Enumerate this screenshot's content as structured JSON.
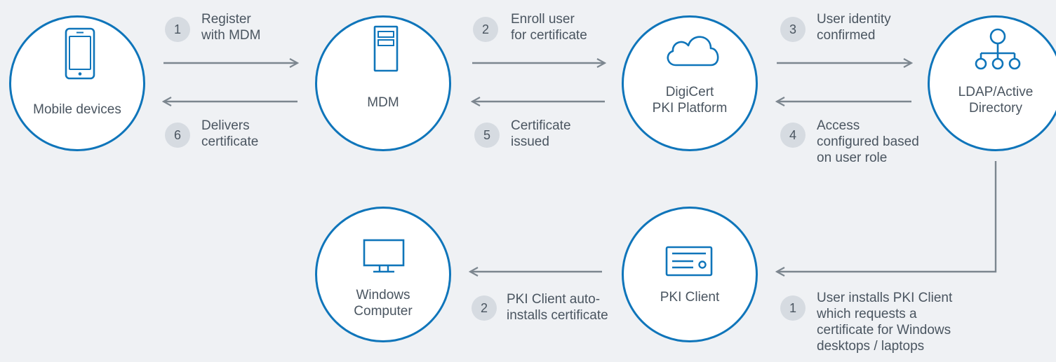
{
  "nodes": {
    "mobile": {
      "lines": [
        "Mobile devices"
      ],
      "icon": "mobile-phone-icon"
    },
    "mdm": {
      "lines": [
        "MDM"
      ],
      "icon": "server-tower-icon"
    },
    "digicert": {
      "lines": [
        "DigiCert",
        "PKI Platform"
      ],
      "icon": "cloud-icon"
    },
    "ldap": {
      "lines": [
        "LDAP/Active",
        "Directory"
      ],
      "icon": "hierarchy-icon"
    },
    "pki_client": {
      "lines": [
        "PKI Client"
      ],
      "icon": "certificate-card-icon"
    },
    "windows": {
      "lines": [
        "Windows",
        "Computer"
      ],
      "icon": "monitor-icon"
    }
  },
  "steps": {
    "s1_register": {
      "number": "1",
      "lines": [
        "Register",
        "with MDM"
      ]
    },
    "s2_enroll": {
      "number": "2",
      "lines": [
        "Enroll user",
        "for certificate"
      ]
    },
    "s3_identity": {
      "number": "3",
      "lines": [
        "User identity",
        "confirmed"
      ]
    },
    "s4_access": {
      "number": "4",
      "lines": [
        "Access",
        "configured based",
        "on user role"
      ]
    },
    "s5_issued": {
      "number": "5",
      "lines": [
        "Certificate",
        "issued"
      ]
    },
    "s6_delivers": {
      "number": "6",
      "lines": [
        "Delivers",
        "certificate"
      ]
    },
    "b1_installs": {
      "number": "1",
      "lines": [
        "User installs PKI Client",
        "which requests a",
        "certificate for Windows",
        "desktops / laptops"
      ]
    },
    "b2_auto": {
      "number": "2",
      "lines": [
        "PKI Client auto-",
        "installs certificate"
      ]
    }
  },
  "colors": {
    "circle_border": "#0f75ba",
    "icon": "#0f75ba",
    "arrow": "#7c868f",
    "badge": "#d6dbe1",
    "text": "#4a5560",
    "background": "#eff1f4"
  }
}
